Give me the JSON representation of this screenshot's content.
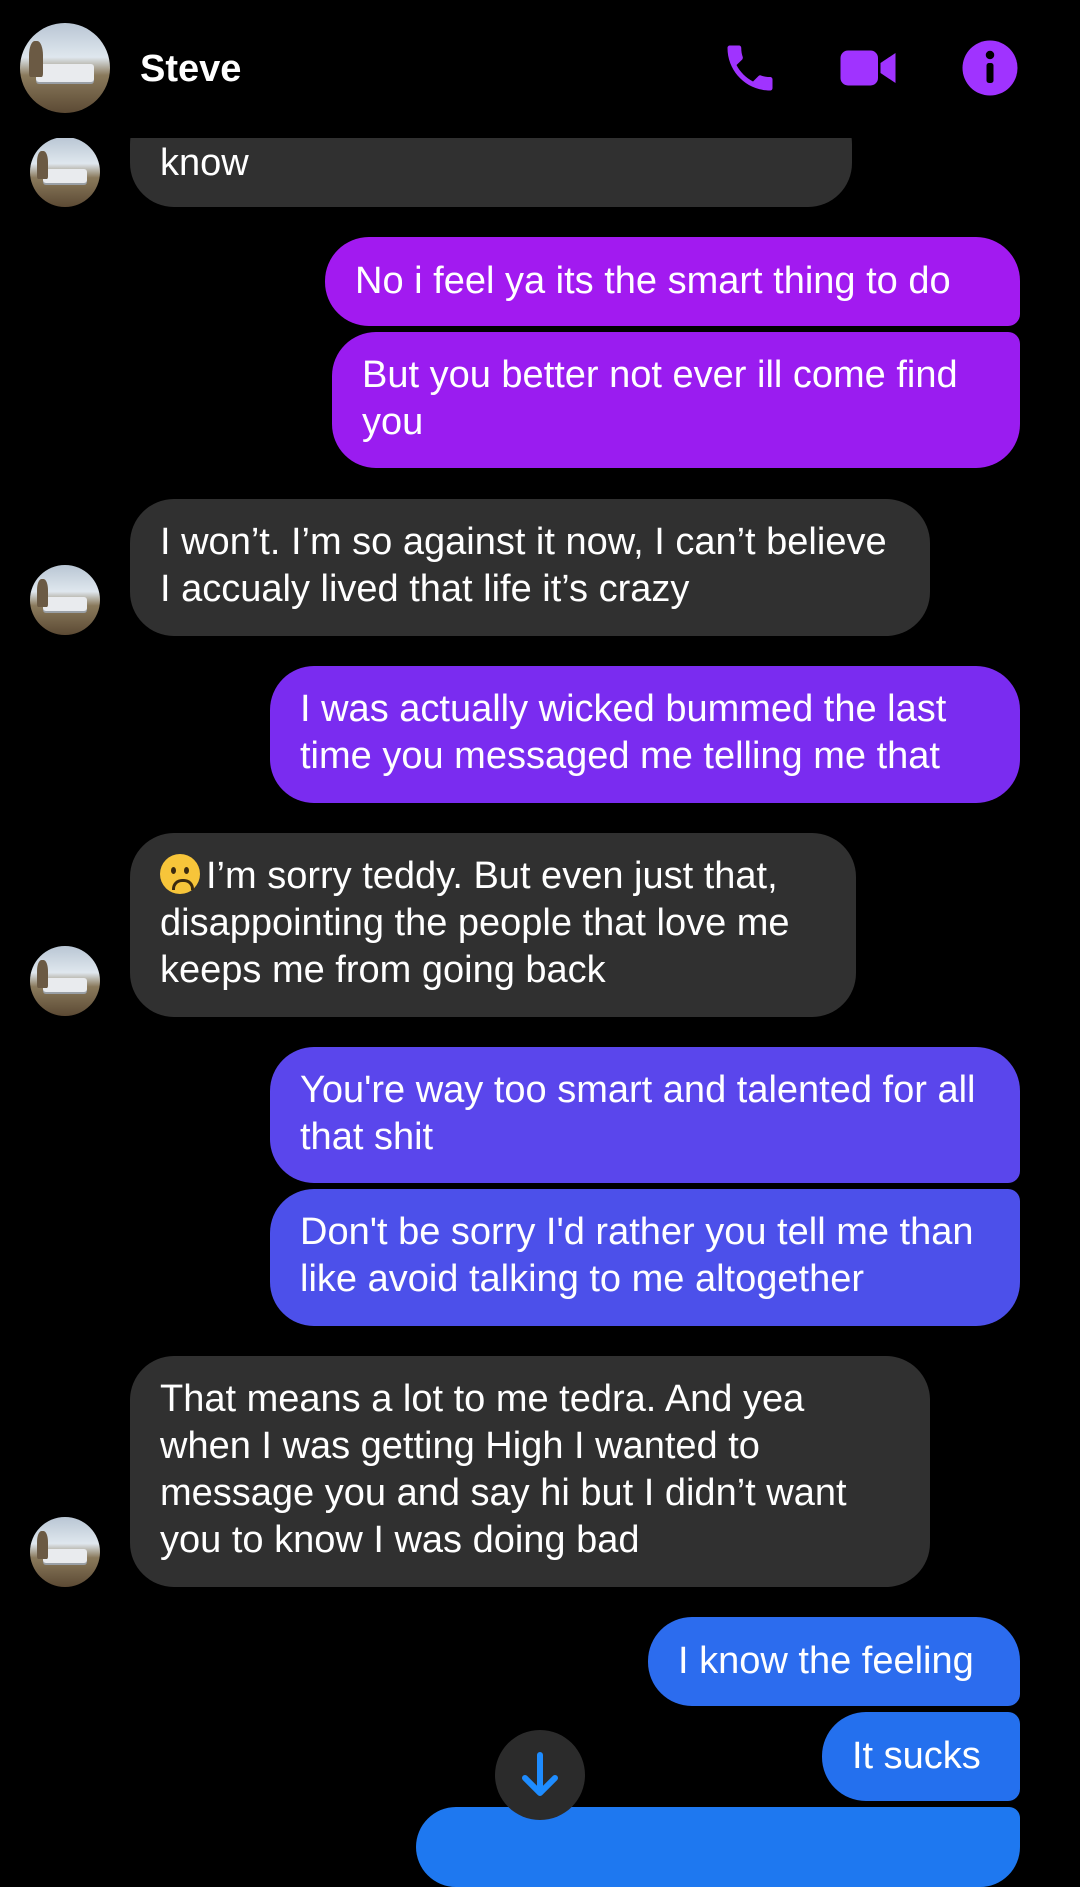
{
  "header": {
    "contact_name": "Steve",
    "accent_color": "#A033FF",
    "icons": [
      "phone-icon",
      "video-camera-icon",
      "info-icon"
    ]
  },
  "messages": [
    {
      "id": "m0",
      "direction": "incoming",
      "text": "know"
    },
    {
      "id": "m1",
      "direction": "outgoing",
      "text": "No i feel ya its the smart thing to do"
    },
    {
      "id": "m2",
      "direction": "outgoing",
      "text": "But you better not ever ill come find you"
    },
    {
      "id": "m3",
      "direction": "incoming",
      "text": "I won’t. I’m so against it now, I can’t believe I accualy lived that life it’s crazy"
    },
    {
      "id": "m4",
      "direction": "outgoing",
      "text": "I was actually wicked bummed the last time you messaged me telling me that"
    },
    {
      "id": "m5",
      "direction": "incoming",
      "text": "I’m sorry teddy. But even just that, disappointing the people that love me keeps me from going back",
      "emoji": "frowning-face-emoji"
    },
    {
      "id": "m6",
      "direction": "outgoing",
      "text": "You're way too smart and talented for all that shit"
    },
    {
      "id": "m7",
      "direction": "outgoing",
      "text": "Don't be sorry I'd rather you tell me than like avoid talking to me altogether"
    },
    {
      "id": "m8",
      "direction": "incoming",
      "text": "That means a lot to me tedra. And yea when I was getting High I wanted to message you and say hi but I didn’t want you to know I was doing bad"
    },
    {
      "id": "m9",
      "direction": "outgoing",
      "text": "I know the feeling"
    },
    {
      "id": "m10",
      "direction": "outgoing",
      "text": "It sucks"
    }
  ],
  "colors": {
    "incoming_bubble": "#303030",
    "outgoing_gradient_top": "#A21AF0",
    "outgoing_gradient_bottom": "#1E78F0",
    "background": "#000000"
  }
}
